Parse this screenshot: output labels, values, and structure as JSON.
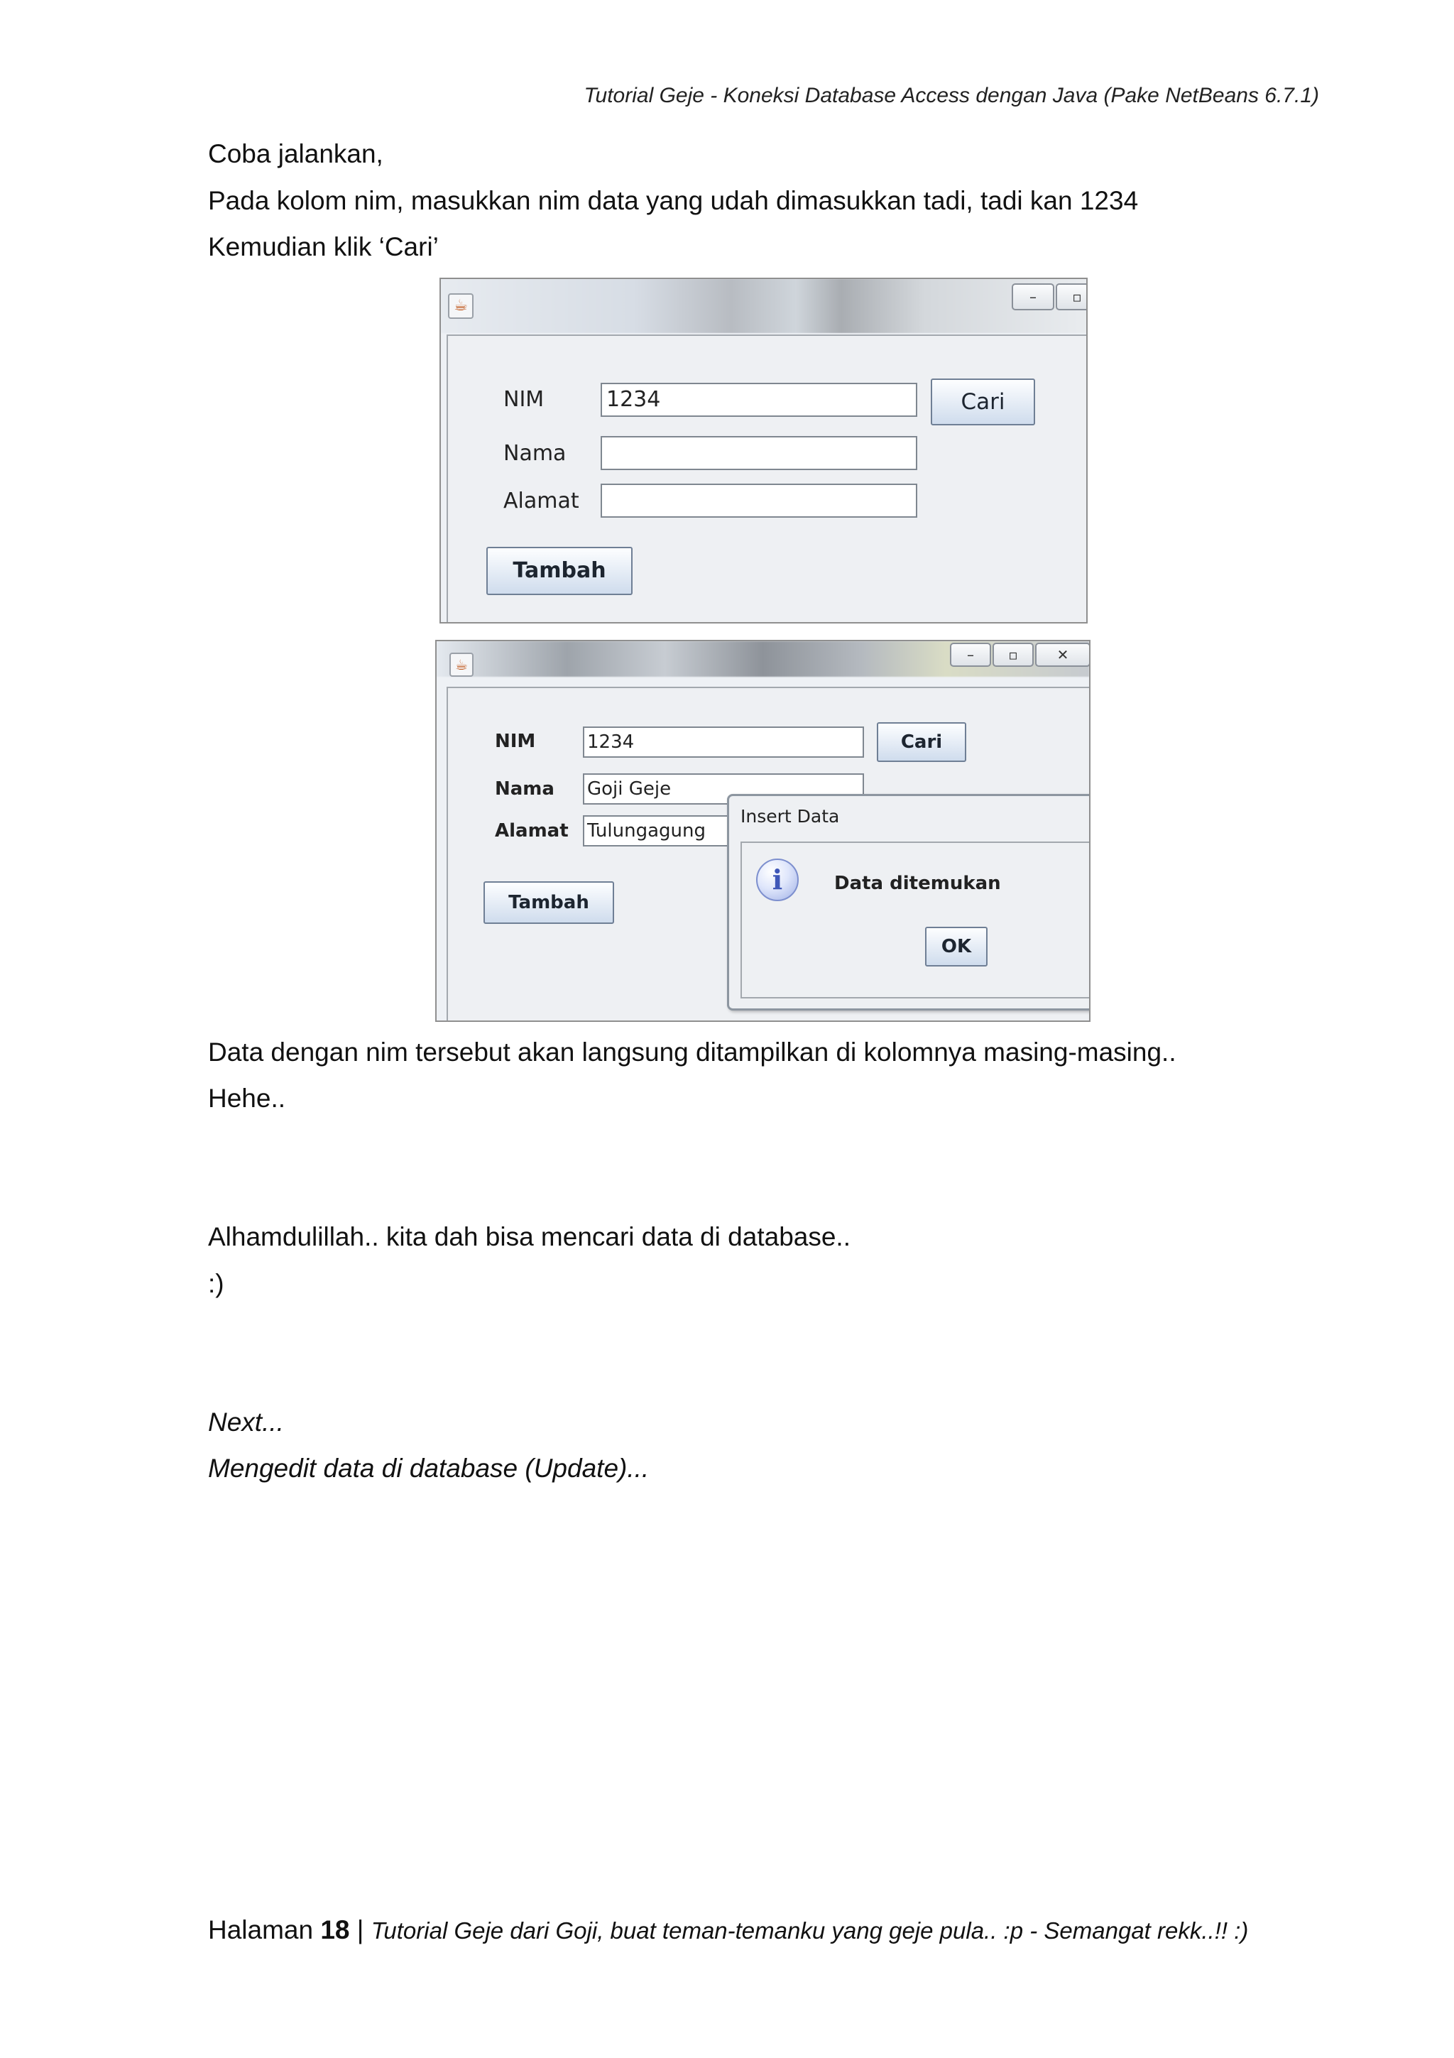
{
  "header": "Tutorial Geje - Koneksi Database Access dengan Java (Pake NetBeans 6.7.1)",
  "intro": [
    "Coba jalankan,",
    "Pada kolom nim, masukkan nim data yang udah dimasukkan tadi, tadi kan 1234",
    "Kemudian klik ‘Cari’"
  ],
  "window1": {
    "title": "",
    "nim_label": "NIM",
    "nama_label": "Nama",
    "alamat_label": "Alamat",
    "nim_value": "1234",
    "nama_value": "",
    "alamat_value": "",
    "cari_button": "Cari",
    "tambah_button": "Tambah"
  },
  "window2": {
    "nim_label": "NIM",
    "nama_label": "Nama",
    "alamat_label": "Alamat",
    "nim_value": "1234",
    "nama_value": "Goji Geje",
    "alamat_value": "Tulungagung",
    "cari_button": "Cari",
    "tambah_button": "Tambah",
    "dialog": {
      "title": "Insert Data",
      "message": "Data ditemukan",
      "ok_button": "OK"
    }
  },
  "window_controls": {
    "minimize": "–",
    "maximize": "▫",
    "close": "✕"
  },
  "after": [
    "Data dengan nim tersebut akan langsung ditampilkan di kolomnya masing-masing..",
    "Hehe.."
  ],
  "closing": [
    "Alhamdulillah.. kita dah bisa mencari data di database..",
    ":)"
  ],
  "next": [
    "Next...",
    "Mengedit data di database (Update)..."
  ],
  "footer": {
    "prefix": "Halaman ",
    "page_number": "18",
    "separator": " | ",
    "text": "Tutorial Geje dari Goji, buat teman-temanku yang geje pula.. :p  -   Semangat rekk..!! :)"
  }
}
